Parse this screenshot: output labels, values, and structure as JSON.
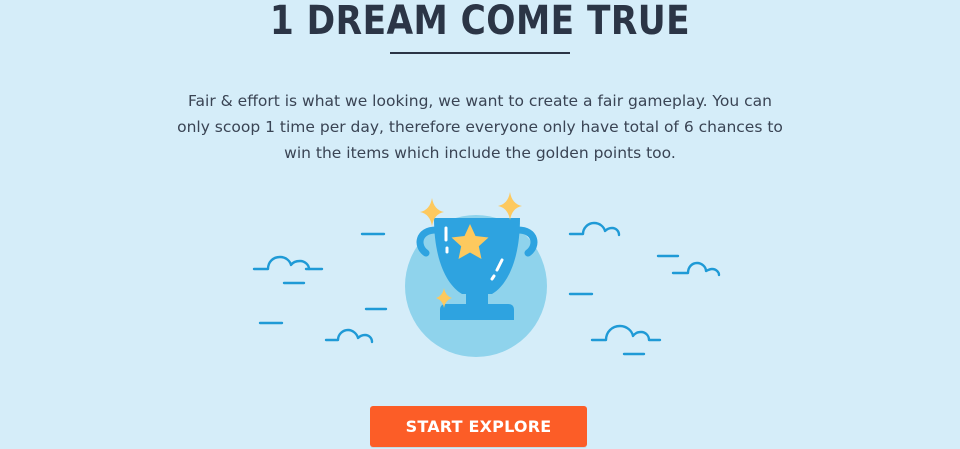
{
  "section": {
    "title": "1 DREAM COME TRUE",
    "description": "Fair & effort is what we looking, we want to create a fair gameplay. You can only scoop 1 time per day, therefore everyone only have total of 6 chances to win the items which include the golden points too."
  },
  "illustration": {
    "icon": "trophy-icon",
    "decorations": [
      "cloud-icon",
      "sparkle-star-icon",
      "dash-line"
    ]
  },
  "cta": {
    "label": "START EXPLORE"
  },
  "colors": {
    "background": "#d5edf9",
    "title": "#2b3546",
    "text": "#3a4454",
    "line_blue": "#1f9ad6",
    "circle": "#8fd3ec",
    "trophy": "#2ea3e0",
    "star": "#fdc95e",
    "button": "#fc5d27"
  }
}
